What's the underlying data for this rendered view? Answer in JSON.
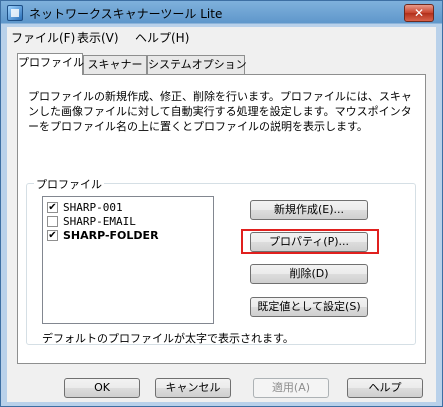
{
  "window": {
    "title": "ネットワークスキャナーツール Lite",
    "close_glyph": "✕"
  },
  "menubar": {
    "items": [
      "ファイル(F)",
      "表示(V)",
      "ヘルプ(H)"
    ]
  },
  "tabs": [
    {
      "label": "プロファイル",
      "active": true
    },
    {
      "label": "スキャナー",
      "active": false
    },
    {
      "label": "システムオプション",
      "active": false
    }
  ],
  "description": "プロファイルの新規作成、修正、削除を行います。プロファイルには、スキャンした画像ファイルに対して自動実行する処理を設定します。マウスポインターをプロファイル名の上に置くとプロファイルの説明を表示します。",
  "profile_group": {
    "label": "プロファイル",
    "items": [
      {
        "label": "SHARP-001",
        "checked": true,
        "bold": false
      },
      {
        "label": "SHARP-EMAIL",
        "checked": false,
        "bold": false
      },
      {
        "label": "SHARP-FOLDER",
        "checked": true,
        "bold": true
      }
    ],
    "check_glyph": "✔",
    "buttons": {
      "new": "新規作成(E)...",
      "properties": "プロパティ(P)...",
      "delete": "削除(D)",
      "set_default": "既定値として設定(S)"
    },
    "footnote": "デフォルトのプロファイルが太字で表示されます。"
  },
  "dialog_buttons": {
    "ok": "OK",
    "cancel": "キャンセル",
    "apply": "適用(A)",
    "help": "ヘルプ"
  },
  "colors": {
    "highlight": "#e0201e",
    "title_gradient_top": "#7fb1dc"
  }
}
